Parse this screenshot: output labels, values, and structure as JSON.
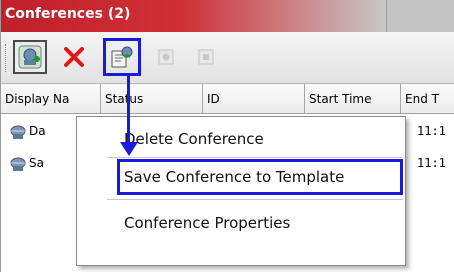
{
  "panel": {
    "title": "Conferences (2)"
  },
  "toolbar": {
    "buttons": [
      {
        "icon": "new-conference-icon"
      },
      {
        "icon": "delete-x-icon"
      },
      {
        "icon": "save-template-icon"
      },
      {
        "icon": "disabled-circle-icon"
      },
      {
        "icon": "disabled-square-icon"
      }
    ]
  },
  "grid": {
    "columns": [
      "Display Na",
      "Status",
      "ID",
      "Start Time",
      "End T"
    ],
    "rows": [
      {
        "name": "Da",
        "end_time": "11:1"
      },
      {
        "name": "Sa",
        "end_time": "11:1"
      }
    ]
  },
  "context_menu": {
    "items": [
      "Delete Conference",
      "Save Conference to Template",
      "Conference Properties"
    ]
  },
  "colors": {
    "title_red": "#c8202a",
    "annotation_blue": "#1a1adb"
  }
}
